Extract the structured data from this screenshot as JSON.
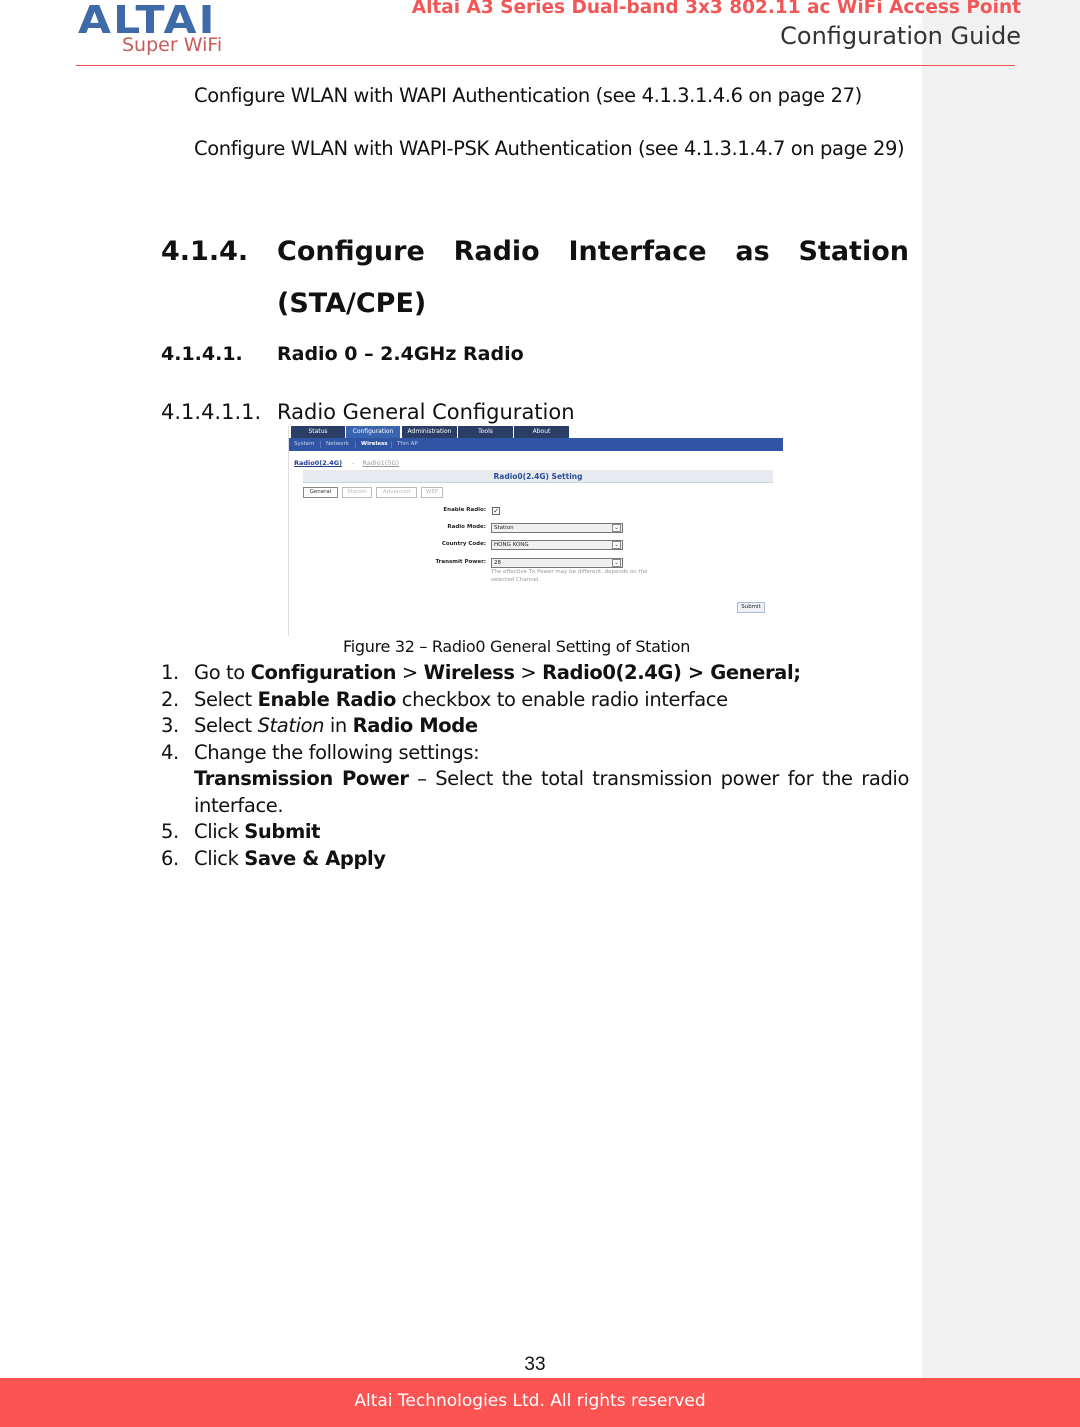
{
  "header": {
    "logo_main": "ALTAI",
    "logo_sub": "Super WiFi",
    "doc_title": "Altai A3 Series Dual-band 3x3 802.11 ac WiFi Access Point",
    "doc_subtitle": "Configuration Guide"
  },
  "intro": {
    "line1": "Configure WLAN with WAPI Authentication (see 4.1.3.1.4.6 on page 27)",
    "line2": "Configure WLAN with WAPI-PSK Authentication (see 4.1.3.1.4.7 on page 29)"
  },
  "section": {
    "number": "4.1.4.",
    "title_line1": "Configure Radio Interface as Station",
    "title_line2": "(STA/CPE)"
  },
  "subsection": {
    "number": "4.1.4.1.",
    "title": "Radio 0 – 2.4GHz Radio"
  },
  "subsubsection": {
    "number": "4.1.4.1.1.",
    "title": "Radio General Configuration"
  },
  "figure": {
    "top_tabs": [
      {
        "label": "Status",
        "active": false
      },
      {
        "label": "Configuration",
        "active": true
      },
      {
        "label": "Administration",
        "active": false
      },
      {
        "label": "Tools",
        "active": false
      },
      {
        "label": "About",
        "active": false
      }
    ],
    "sub_nav": [
      {
        "label": "System",
        "active": false
      },
      {
        "label": "Network",
        "active": false
      },
      {
        "label": "Wireless",
        "active": true
      },
      {
        "label": "Thin AP",
        "active": false
      }
    ],
    "radio_links": {
      "active": "Radio0(2.4G)",
      "separator": "-",
      "other": "Radio1(5G)"
    },
    "setting_title": "Radio0(2.4G) Setting",
    "sub_tabs": [
      {
        "label": "General",
        "active": true
      },
      {
        "label": "Station",
        "active": false
      },
      {
        "label": "Advanced",
        "active": false
      },
      {
        "label": "WEP",
        "active": false
      }
    ],
    "fields": {
      "enable_radio_label": "Enable Radio:",
      "enable_radio_checked": true,
      "enable_radio_mark": "✓",
      "radio_mode_label": "Radio Mode:",
      "radio_mode_value": "Station",
      "country_code_label": "Country Code:",
      "country_code_value": "HONG KONG",
      "transmit_power_label": "Transmit Power:",
      "transmit_power_value": "28",
      "transmit_power_hint": "The effective Tx Power may be different, depends on the selected Channel.",
      "dropdown_arrow": "⌄"
    },
    "submit_label": "Submit",
    "caption": "Figure 32 – Radio0 General Setting of Station"
  },
  "steps": [
    {
      "n": "1.",
      "parts": [
        {
          "t": "Go to "
        },
        {
          "t": "Configuration",
          "b": true
        },
        {
          "t": " > "
        },
        {
          "t": "Wireless",
          "b": true
        },
        {
          "t": " > "
        },
        {
          "t": "Radio0(2.4G) > General;",
          "b": true
        }
      ]
    },
    {
      "n": "2.",
      "parts": [
        {
          "t": "Select "
        },
        {
          "t": "Enable Radio",
          "b": true
        },
        {
          "t": " checkbox to enable radio interface"
        }
      ]
    },
    {
      "n": "3.",
      "parts": [
        {
          "t": "Select "
        },
        {
          "t": "Station",
          "i": true
        },
        {
          "t": " in "
        },
        {
          "t": "Radio Mode",
          "b": true
        }
      ]
    },
    {
      "n": "4.",
      "parts": [
        {
          "t": "Change the following settings:"
        }
      ],
      "detail_label": "Transmission Power",
      "detail_text": " – Select the total transmission power for the radio interface."
    },
    {
      "n": "5.",
      "parts": [
        {
          "t": "Click "
        },
        {
          "t": "Submit",
          "b": true
        }
      ]
    },
    {
      "n": "6.",
      "parts": [
        {
          "t": "Click "
        },
        {
          "t": "Save & Apply",
          "b": true
        }
      ]
    }
  ],
  "footer": {
    "page_number": "33",
    "copyright": "Altai Technologies Ltd. All rights reserved"
  }
}
